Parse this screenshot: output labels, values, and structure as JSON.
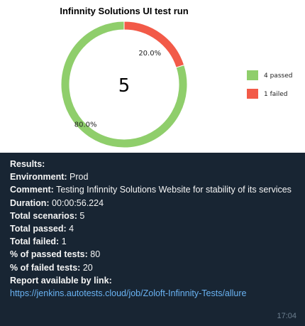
{
  "chart_data": {
    "type": "pie",
    "title": "Infinnity Solutions UI test run",
    "center_value": "5",
    "categories": [
      "4 passed",
      "1 failed"
    ],
    "values": [
      4,
      1
    ],
    "slice_labels": [
      "80.0%",
      "20.0%"
    ],
    "colors": [
      "#8fce6b",
      "#f25a48"
    ],
    "legend_position": "right"
  },
  "results": {
    "heading": "Results:",
    "environment_label": "Environment:",
    "environment_value": "Prod",
    "comment_label": "Comment:",
    "comment_value": "Testing Infinnity Solutions Website for stability of its services",
    "duration_label": "Duration:",
    "duration_value": "00:00:56.224",
    "total_scenarios_label": "Total scenarios:",
    "total_scenarios_value": "5",
    "total_passed_label": "Total passed:",
    "total_passed_value": "4",
    "total_failed_label": "Total failed:",
    "total_failed_value": "1",
    "passed_pct_label": "% of passed tests:",
    "passed_pct_value": "80",
    "failed_pct_label": "% of failed tests:",
    "failed_pct_value": "20",
    "report_label": "Report available by link:",
    "report_link": "https://jenkins.autotests.cloud/job/Zoloft-Infinnity-Tests/allure"
  },
  "message": {
    "time": "17:04"
  }
}
